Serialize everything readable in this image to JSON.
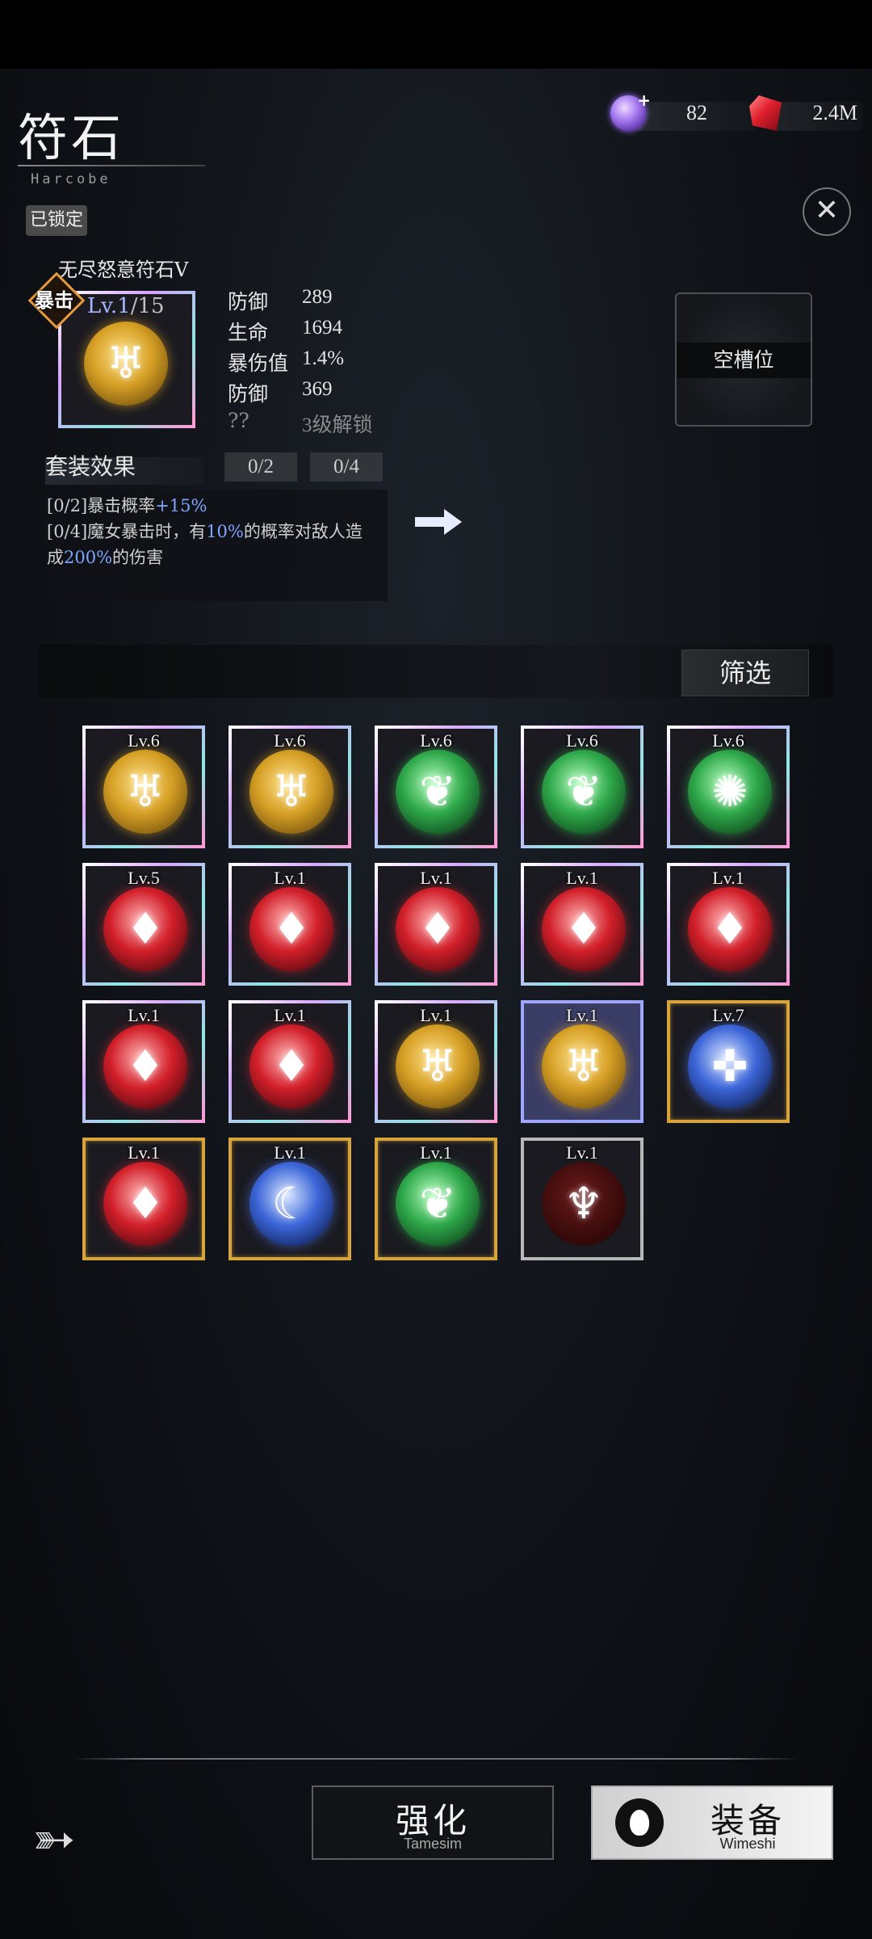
{
  "header": {
    "title": "符石",
    "subtitle": "Harcobe",
    "currencies": [
      {
        "icon": "purple-gem-plus-icon",
        "value": "82"
      },
      {
        "icon": "red-crystal-icon",
        "value": "2.4M"
      }
    ]
  },
  "locked_label": "已锁定",
  "close_icon": "close-x-icon",
  "selected_rune": {
    "name": "无尽怒意符石Ⅴ",
    "badge": "暴击",
    "level": "Lv.1",
    "level_max": "/15",
    "icon": "golden-fang-rune-icon",
    "stats": [
      {
        "key": "防御",
        "value": "289"
      },
      {
        "key": "生命",
        "value": "1694"
      },
      {
        "key": "暴伤值",
        "value": "1.4%"
      },
      {
        "key": "防御",
        "value": "369"
      },
      {
        "key": "??",
        "value": "3级解锁"
      }
    ]
  },
  "empty_slot_label": "空槽位",
  "set_effect": {
    "title": "套装效果",
    "counters": [
      "0/2",
      "0/4"
    ],
    "line1_prefix": "[0/2]暴击概率",
    "line1_value": "+15%",
    "line2_prefix": "[0/4]魔女暴击时，有",
    "line2_value1": "10%",
    "line2_mid": "的概率对敌人造",
    "line3_prefix": "成",
    "line3_value": "200%",
    "line3_suffix": "的伤害"
  },
  "filter_label": "筛选",
  "inventory": [
    {
      "level": "Lv.6",
      "type": "gold",
      "frame": "rainbow",
      "icon": "fang-icon"
    },
    {
      "level": "Lv.6",
      "type": "gold",
      "frame": "rainbow",
      "icon": "fang-icon"
    },
    {
      "level": "Lv.6",
      "type": "green",
      "frame": "rainbow",
      "icon": "drop-icon"
    },
    {
      "level": "Lv.6",
      "type": "green",
      "frame": "rainbow",
      "icon": "drop-icon"
    },
    {
      "level": "Lv.6",
      "type": "green",
      "frame": "rainbow",
      "icon": "swirl-icon"
    },
    {
      "level": "Lv.5",
      "type": "red",
      "frame": "rainbow",
      "icon": "flame-icon"
    },
    {
      "level": "Lv.1",
      "type": "red",
      "frame": "rainbow",
      "icon": "flame-icon"
    },
    {
      "level": "Lv.1",
      "type": "red",
      "frame": "rainbow",
      "icon": "flame-icon"
    },
    {
      "level": "Lv.1",
      "type": "red",
      "frame": "rainbow",
      "icon": "flame-icon"
    },
    {
      "level": "Lv.1",
      "type": "red",
      "frame": "rainbow",
      "icon": "flame-icon"
    },
    {
      "level": "Lv.1",
      "type": "red",
      "frame": "rainbow",
      "icon": "flame-icon"
    },
    {
      "level": "Lv.1",
      "type": "red",
      "frame": "rainbow",
      "icon": "flame-icon"
    },
    {
      "level": "Lv.1",
      "type": "gold",
      "frame": "rainbow",
      "icon": "fang-icon"
    },
    {
      "level": "Lv.1",
      "type": "gold",
      "frame": "selected",
      "icon": "fang-icon"
    },
    {
      "level": "Lv.7",
      "type": "blue",
      "frame": "gold",
      "icon": "cross-star-icon"
    },
    {
      "level": "Lv.1",
      "type": "red",
      "frame": "gold",
      "icon": "flame-icon"
    },
    {
      "level": "Lv.1",
      "type": "blue",
      "frame": "gold",
      "icon": "moon-star-icon"
    },
    {
      "level": "Lv.1",
      "type": "green",
      "frame": "gold",
      "icon": "drop-icon"
    },
    {
      "level": "Lv.1",
      "type": "redtree",
      "frame": "silver",
      "icon": "tree-icon"
    }
  ],
  "buttons": {
    "enhance": {
      "label": "强化",
      "sub": "Tamesim"
    },
    "equip": {
      "label": "装备",
      "sub": "Wimeshi"
    }
  },
  "colors": {
    "accent_blue": "#7fa6ff",
    "gold_frame": "#d7a43c",
    "selected_frame": "#9fa6ff"
  }
}
